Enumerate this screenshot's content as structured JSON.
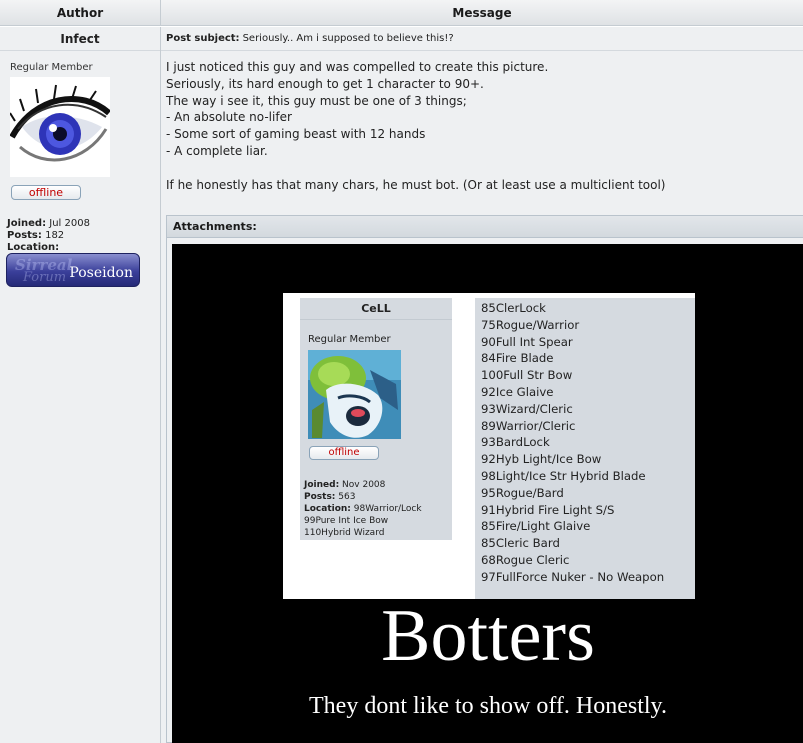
{
  "header": {
    "author_label": "Author",
    "message_label": "Message"
  },
  "post": {
    "username": "Infect",
    "rank": "Regular Member",
    "status": "offline",
    "joined_label": "Joined:",
    "joined_value": "Jul 2008",
    "posts_label": "Posts:",
    "posts_value": "182",
    "location_label": "Location:",
    "location_value": "",
    "badge_text": "Poseidon",
    "subject_label": "Post subject:",
    "subject": "Seriously.. Am i supposed to believe this!?",
    "message_lines": [
      "I just noticed this guy and was compelled to create this picture.",
      "Seriously, its hard enough to get 1 character to 90+.",
      "The way i see it, this guy must be one of 3 things;",
      "- An absolute no-lifer",
      "- Some sort of gaming beast with 12 hands",
      "- A complete liar.",
      "",
      "If he honestly has that many chars, he must bot. (Or at least use a multiclient tool)"
    ]
  },
  "attachments": {
    "label": "Attachments:",
    "image": {
      "card_username": "CeLL",
      "card_rank": "Regular Member",
      "card_status": "offline",
      "card_joined_label": "Joined:",
      "card_joined_value": "Nov 2008",
      "card_posts_label": "Posts:",
      "card_posts_value": "563",
      "card_location_label": "Location:",
      "card_location_lines": [
        "98Warrior/Lock",
        "99Pure Int Ice Bow",
        "110Hybrid Wizard"
      ],
      "characters": [
        "85ClerLock",
        "75Rogue/Warrior",
        "90Full Int Spear",
        "84Fire Blade",
        "100Full Str Bow",
        "92Ice Glaive",
        "93Wizard/Cleric",
        "89Warrior/Cleric",
        "93BardLock",
        "92Hyb Light/Ice Bow",
        "98Light/Ice Str Hybrid Blade",
        "95Rogue/Bard",
        "91Hybrid Fire Light S/S",
        "85Fire/Light Glaive",
        "85Cleric Bard",
        "68Rogue Cleric",
        "97FullForce Nuker - No Weapon"
      ],
      "title": "Botters",
      "subtitle": "They dont like to show off. Honestly."
    }
  },
  "colors": {
    "offline": "#c00000",
    "panel": "#eef0f2",
    "header": "#dfe2e5",
    "card_panel": "#d5dae0"
  }
}
